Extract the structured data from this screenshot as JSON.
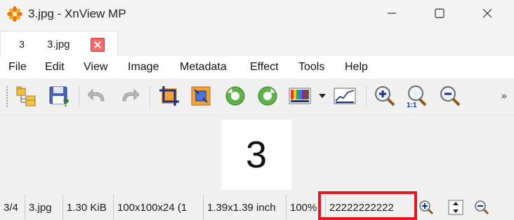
{
  "window": {
    "title": "3.jpg - XnView MP",
    "app_icon": "xnview-flower-icon",
    "controls": [
      "minimize-icon",
      "maximize-icon",
      "close-icon"
    ]
  },
  "tabs": [
    {
      "thumb_text": "3",
      "label": "3.jpg",
      "close_icon": "tab-close-icon"
    }
  ],
  "menu": [
    "File",
    "Edit",
    "View",
    "Image",
    "Metadata",
    "Effect",
    "Tools",
    "Help"
  ],
  "toolbar": {
    "buttons": [
      "browse-folder-icon",
      "save-icon",
      "undo-icon",
      "redo-icon",
      "crop-icon",
      "resize-icon",
      "rotate-left-icon",
      "rotate-right-icon",
      "adjust-colors-icon",
      "levels-icon",
      "zoom-in-icon",
      "zoom-1to1-icon",
      "zoom-out-icon"
    ],
    "overflow": "»"
  },
  "image": {
    "text": "3"
  },
  "status": {
    "position": "3/4",
    "filename": "3.jpg",
    "filesize": "1.30 KiB",
    "dimensions": "100x100x24 (1",
    "print_size": "1.39x1.39 inch",
    "zoom": "100%",
    "value": "22222222222"
  },
  "colors": {
    "highlight": "#e01a22",
    "tab_close": "#f26a6a"
  }
}
